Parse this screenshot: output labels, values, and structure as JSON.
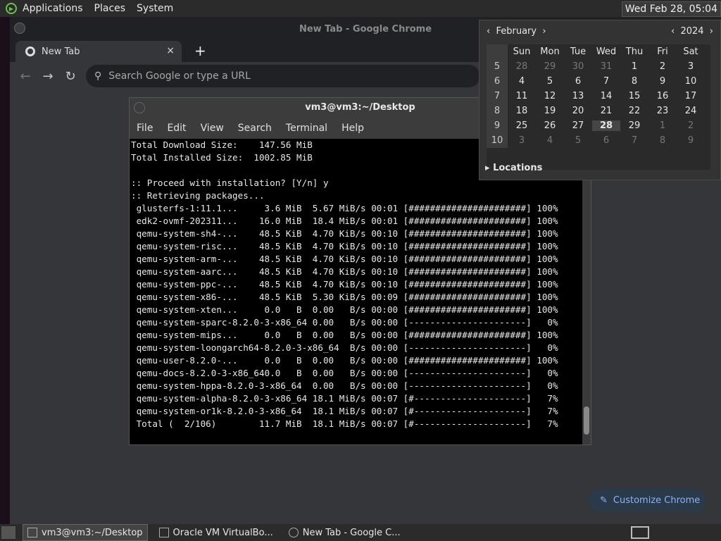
{
  "top_panel": {
    "menus": [
      "Applications",
      "Places",
      "System"
    ],
    "clock": "Wed Feb 28, 05:04"
  },
  "chrome": {
    "window_title": "New Tab - Google Chrome",
    "tab_label": "New Tab",
    "tab_close": "×",
    "new_tab": "+",
    "omnibox_placeholder": "Search Google or type a URL",
    "customize_label": "Customize Chrome"
  },
  "terminal": {
    "title": "vm3@vm3:~/Desktop",
    "menus": [
      "File",
      "Edit",
      "View",
      "Search",
      "Terminal",
      "Help"
    ],
    "lines": [
      "Total Download Size:    147.56 MiB",
      "Total Installed Size:  1002.85 MiB",
      "",
      ":: Proceed with installation? [Y/n] y",
      ":: Retrieving packages...",
      " glusterfs-1:11.1...     3.6 MiB  5.67 MiB/s 00:01 [######################] 100%",
      " edk2-ovmf-202311...    16.0 MiB  18.4 MiB/s 00:01 [######################] 100%",
      " qemu-system-sh4-...    48.5 KiB  4.70 KiB/s 00:10 [######################] 100%",
      " qemu-system-risc...    48.5 KiB  4.70 KiB/s 00:10 [######################] 100%",
      " qemu-system-arm-...    48.5 KiB  4.70 KiB/s 00:10 [######################] 100%",
      " qemu-system-aarc...    48.5 KiB  4.70 KiB/s 00:10 [######################] 100%",
      " qemu-system-ppc-...    48.5 KiB  4.70 KiB/s 00:10 [######################] 100%",
      " qemu-system-x86-...    48.5 KiB  5.30 KiB/s 00:09 [######################] 100%",
      " qemu-system-xten...     0.0   B  0.00   B/s 00:00 [######################] 100%",
      " qemu-system-sparc-8.2.0-3-x86_64 0.00   B/s 00:00 [----------------------]   0%",
      " qemu-system-mips...     0.0   B  0.00   B/s 00:00 [######################] 100%",
      " qemu-system-loongarch64-8.2.0-3-x86_64  B/s 00:00 [----------------------]   0%",
      " qemu-user-8.2.0-...     0.0   B  0.00   B/s 00:00 [######################] 100%",
      " qemu-docs-8.2.0-3-x86_640.0   B  0.00   B/s 00:00 [----------------------]   0%",
      " qemu-system-hppa-8.2.0-3-x86_64  0.00   B/s 00:00 [----------------------]   0%",
      " qemu-system-alpha-8.2.0-3-x86_64 18.1 MiB/s 00:07 [#---------------------]   7%",
      " qemu-system-or1k-8.2.0-3-x86_64  18.1 MiB/s 00:07 [#---------------------]   7%",
      " Total (  2/106)        11.7 MiB  18.1 MiB/s 00:07 [#---------------------]   7%"
    ]
  },
  "calendar": {
    "month": "February",
    "year": "2024",
    "weekdays": [
      "Sun",
      "Mon",
      "Tue",
      "Wed",
      "Thu",
      "Fri",
      "Sat"
    ],
    "weeks": [
      {
        "wk": "5",
        "days": [
          "28",
          "29",
          "30",
          "31",
          "1",
          "2",
          "3"
        ],
        "dim": [
          1,
          1,
          1,
          1,
          0,
          0,
          0
        ]
      },
      {
        "wk": "6",
        "days": [
          "4",
          "5",
          "6",
          "7",
          "8",
          "9",
          "10"
        ],
        "dim": [
          0,
          0,
          0,
          0,
          0,
          0,
          0
        ]
      },
      {
        "wk": "7",
        "days": [
          "11",
          "12",
          "13",
          "14",
          "15",
          "16",
          "17"
        ],
        "dim": [
          0,
          0,
          0,
          0,
          0,
          0,
          0
        ]
      },
      {
        "wk": "8",
        "days": [
          "18",
          "19",
          "20",
          "21",
          "22",
          "23",
          "24"
        ],
        "dim": [
          0,
          0,
          0,
          0,
          0,
          0,
          0
        ]
      },
      {
        "wk": "9",
        "days": [
          "25",
          "26",
          "27",
          "28",
          "29",
          "1",
          "2"
        ],
        "dim": [
          0,
          0,
          0,
          0,
          0,
          1,
          1
        ]
      },
      {
        "wk": "10",
        "days": [
          "3",
          "4",
          "5",
          "6",
          "7",
          "8",
          "9"
        ],
        "dim": [
          1,
          1,
          1,
          1,
          1,
          1,
          1
        ]
      }
    ],
    "today": "28",
    "locations_label": "Locations"
  },
  "taskbar": {
    "tasks": [
      "vm3@vm3:~/Desktop",
      "Oracle VM VirtualBo...",
      "New Tab - Google C..."
    ]
  }
}
